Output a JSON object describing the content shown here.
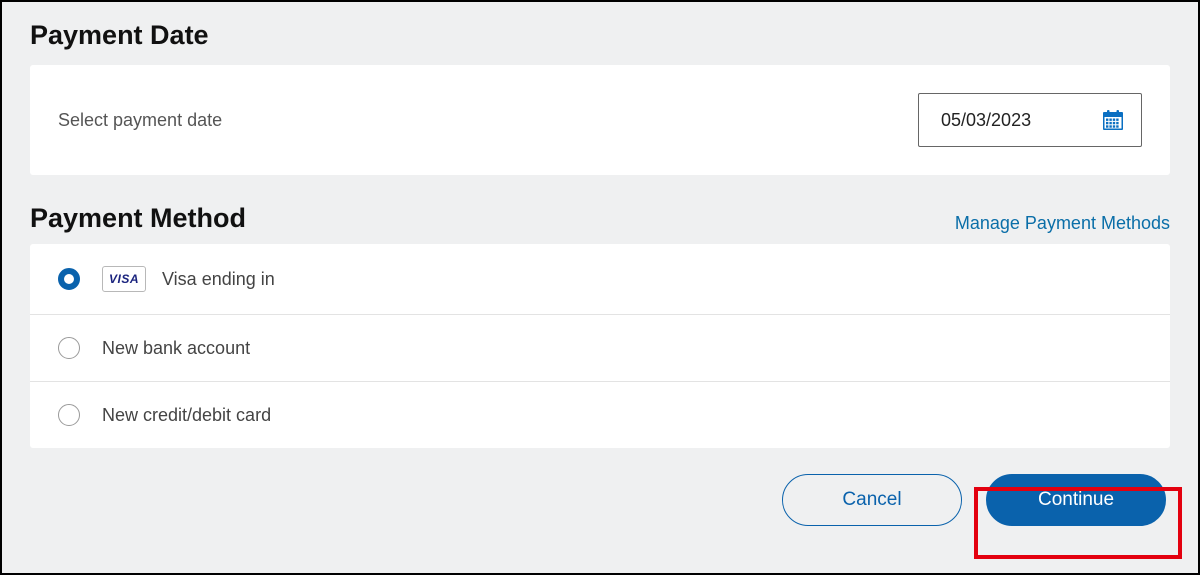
{
  "payment_date": {
    "title": "Payment Date",
    "label": "Select payment date",
    "value": "05/03/2023"
  },
  "payment_method": {
    "title": "Payment Method",
    "manage_link": "Manage Payment Methods",
    "options": [
      {
        "label": "Visa ending in",
        "visa_text": "VISA"
      },
      {
        "label": "New bank account"
      },
      {
        "label": "New credit/debit card"
      }
    ]
  },
  "actions": {
    "cancel": "Cancel",
    "continue": "Continue"
  }
}
